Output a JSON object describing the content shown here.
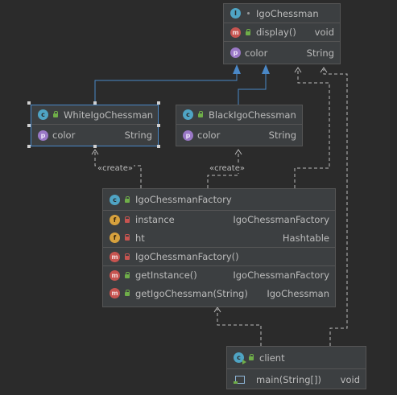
{
  "interface": {
    "name": "IgoChessman",
    "badge": "I",
    "methods": [
      {
        "name": "display()",
        "type": "void",
        "badge": "m"
      }
    ],
    "fields": [
      {
        "name": "color",
        "type": "String",
        "badge": "p"
      }
    ]
  },
  "white": {
    "name": "WhiteIgoChessman",
    "badge": "c",
    "fields": [
      {
        "name": "color",
        "type": "String",
        "badge": "p"
      }
    ]
  },
  "black": {
    "name": "BlackIgoChessman",
    "badge": "c",
    "fields": [
      {
        "name": "color",
        "type": "String",
        "badge": "p"
      }
    ]
  },
  "factory": {
    "name": "IgoChessmanFactory",
    "badge": "c",
    "fields": [
      {
        "name": "instance",
        "type": "IgoChessmanFactory",
        "badge": "f"
      },
      {
        "name": "ht",
        "type": "Hashtable",
        "badge": "f"
      }
    ],
    "constructor": {
      "name": "IgoChessmanFactory()",
      "badge": "m"
    },
    "methods": [
      {
        "name": "getInstance()",
        "type": "IgoChessmanFactory",
        "badge": "m"
      },
      {
        "name": "getIgoChessman(String)",
        "type": "IgoChessman",
        "badge": "m"
      }
    ]
  },
  "client": {
    "name": "client",
    "badge": "c",
    "methods": [
      {
        "name": "main(String[])",
        "type": "void"
      }
    ]
  },
  "labels": {
    "creates_left": "«create»",
    "creates_right": "«create»"
  },
  "colors": {
    "background": "#2b2b2b",
    "node": "#3c3f41",
    "border": "#555555",
    "selection": "#4a88c7",
    "realization": "#4a88c7",
    "dependency": "#bbbbbb"
  }
}
